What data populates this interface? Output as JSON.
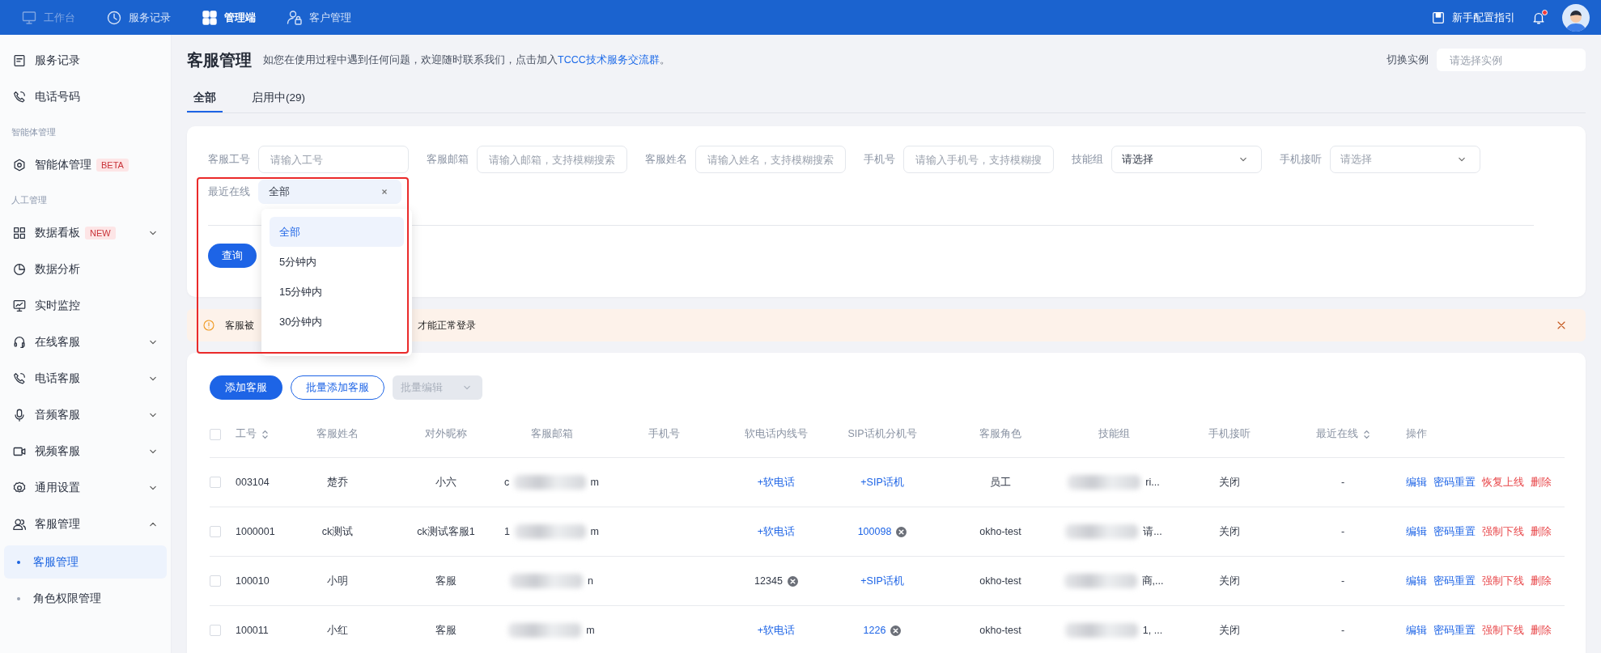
{
  "top_bar": {
    "nav": [
      {
        "label": "工作台",
        "selected": false,
        "disabled": true
      },
      {
        "label": "服务记录",
        "selected": false,
        "disabled": false
      },
      {
        "label": "管理端",
        "selected": true,
        "disabled": false
      },
      {
        "label": "客户管理",
        "selected": false,
        "disabled": false
      }
    ],
    "guide_link": "新手配置指引",
    "notification_dot": true
  },
  "sidebar": {
    "items": [
      {
        "kind": "item",
        "label": "服务记录"
      },
      {
        "kind": "item",
        "label": "电话号码"
      },
      {
        "kind": "section",
        "label": "智能体管理"
      },
      {
        "kind": "item",
        "label": "智能体管理",
        "badge": "BETA"
      },
      {
        "kind": "section",
        "label": "人工管理"
      },
      {
        "kind": "group",
        "label": "数据看板",
        "badge": "NEW",
        "expanded": false
      },
      {
        "kind": "item",
        "label": "数据分析"
      },
      {
        "kind": "item",
        "label": "实时监控"
      },
      {
        "kind": "group",
        "label": "在线客服",
        "expanded": false
      },
      {
        "kind": "group",
        "label": "电话客服",
        "expanded": false
      },
      {
        "kind": "group",
        "label": "音频客服",
        "expanded": false
      },
      {
        "kind": "group",
        "label": "视频客服",
        "expanded": false
      },
      {
        "kind": "group",
        "label": "通用设置",
        "expanded": false
      },
      {
        "kind": "group",
        "label": "客服管理",
        "expanded": true,
        "children": [
          {
            "label": "客服管理",
            "selected": true
          },
          {
            "label": "角色权限管理",
            "selected": false
          }
        ]
      }
    ]
  },
  "header": {
    "title": "客服管理",
    "description": "如您在使用过程中遇到任何问题，欢迎随时联系我们，点击加入",
    "link": "TCCC技术服务交流群",
    "description_end": "。",
    "instance_label": "切换实例",
    "instance_placeholder": "请选择实例"
  },
  "tabs": [
    {
      "label": "全部",
      "selected": true
    },
    {
      "label": "启用中(29)",
      "selected": false
    }
  ],
  "filters": [
    {
      "kind": "input",
      "label": "客服工号",
      "placeholder": "请输入工号"
    },
    {
      "kind": "input",
      "label": "客服邮箱",
      "placeholder": "请输入邮箱，支持模糊搜索"
    },
    {
      "kind": "input",
      "label": "客服姓名",
      "placeholder": "请输入姓名，支持模糊搜索"
    },
    {
      "kind": "input",
      "label": "手机号",
      "placeholder": "请输入手机号，支持模糊搜"
    },
    {
      "kind": "select",
      "label": "技能组",
      "value": "请选择"
    },
    {
      "kind": "select",
      "label": "手机接听",
      "placeholder": "请选择"
    },
    {
      "kind": "open-select",
      "label": "最近在线",
      "value": "全部",
      "options": [
        {
          "label": "全部",
          "selected": true
        },
        {
          "label": "5分钟内",
          "selected": false
        },
        {
          "label": "15分钟内",
          "selected": false
        },
        {
          "label": "30分钟内",
          "selected": false
        }
      ]
    }
  ],
  "query_button": "查询",
  "alert": {
    "text_start": "客服被",
    "text_end": "才能正常登录"
  },
  "toolbar": {
    "add_button": "添加客服",
    "batch_add_button": "批量添加客服",
    "batch_edit_button": "批量编辑",
    "batch_edit_disabled": true
  },
  "table": {
    "select_all": {
      "checked": false
    },
    "columns": [
      {
        "label": "工号",
        "sortable": true
      },
      {
        "label": "客服姓名",
        "sortable": false
      },
      {
        "label": "对外昵称",
        "sortable": false
      },
      {
        "label": "客服邮箱",
        "sortable": false
      },
      {
        "label": "手机号",
        "sortable": false
      },
      {
        "label": "软电话内线号",
        "sortable": false
      },
      {
        "label": "SIP话机分机号",
        "sortable": false
      },
      {
        "label": "客服角色",
        "sortable": false
      },
      {
        "label": "技能组",
        "sortable": false
      },
      {
        "label": "手机接听",
        "sortable": false
      },
      {
        "label": "最近在线",
        "sortable": true
      },
      {
        "label": "操作",
        "sortable": false
      }
    ],
    "rows": [
      {
        "checked": false,
        "id": "003104",
        "name": "楚乔",
        "nickname": "小六",
        "email": {
          "prefix": "c",
          "suffix": "m"
        },
        "softphone": {
          "kind": "add",
          "text": "+软电话"
        },
        "sip": {
          "kind": "add",
          "text": "+SIP话机"
        },
        "role": "员工",
        "skill_group": "ri...",
        "mobile_answer": "关闭",
        "last_online": "-",
        "actions": [
          {
            "label": "编辑",
            "kind": "primary"
          },
          {
            "label": "密码重置",
            "kind": "primary"
          },
          {
            "label": "恢复上线",
            "kind": "danger"
          },
          {
            "label": "删除",
            "kind": "danger"
          }
        ]
      },
      {
        "checked": false,
        "id": "1000001",
        "name": "ck测试",
        "nickname": "ck测试客服1",
        "email": {
          "prefix": "1",
          "suffix": "m"
        },
        "softphone": {
          "kind": "add",
          "text": "+软电话"
        },
        "sip": {
          "kind": "link",
          "text": "100098"
        },
        "role": "okho-test",
        "skill_group": "请...",
        "mobile_answer": "关闭",
        "last_online": "-",
        "actions": [
          {
            "label": "编辑",
            "kind": "primary"
          },
          {
            "label": "密码重置",
            "kind": "primary"
          },
          {
            "label": "强制下线",
            "kind": "danger"
          },
          {
            "label": "删除",
            "kind": "danger"
          }
        ]
      },
      {
        "checked": false,
        "id": "100010",
        "name": "小明",
        "nickname": "客服",
        "email": {
          "suffix": "n"
        },
        "softphone": {
          "kind": "plain",
          "text": "12345"
        },
        "sip": {
          "kind": "add",
          "text": "+SIP话机"
        },
        "role": "okho-test",
        "skill_group": "商,...",
        "mobile_answer": "关闭",
        "last_online": "-",
        "actions": [
          {
            "label": "编辑",
            "kind": "primary"
          },
          {
            "label": "密码重置",
            "kind": "primary"
          },
          {
            "label": "强制下线",
            "kind": "danger"
          },
          {
            "label": "删除",
            "kind": "danger"
          }
        ]
      },
      {
        "checked": false,
        "id": "100011",
        "name": "小红",
        "nickname": "客服",
        "email": {
          "suffix": "m"
        },
        "softphone": {
          "kind": "add",
          "text": "+软电话"
        },
        "sip": {
          "kind": "link",
          "text": "1226"
        },
        "role": "okho-test",
        "skill_group": "1, ...",
        "mobile_answer": "关闭",
        "last_online": "-",
        "actions": [
          {
            "label": "编辑",
            "kind": "primary"
          },
          {
            "label": "密码重置",
            "kind": "primary"
          },
          {
            "label": "强制下线",
            "kind": "danger"
          },
          {
            "label": "删除",
            "kind": "danger"
          }
        ]
      }
    ]
  }
}
